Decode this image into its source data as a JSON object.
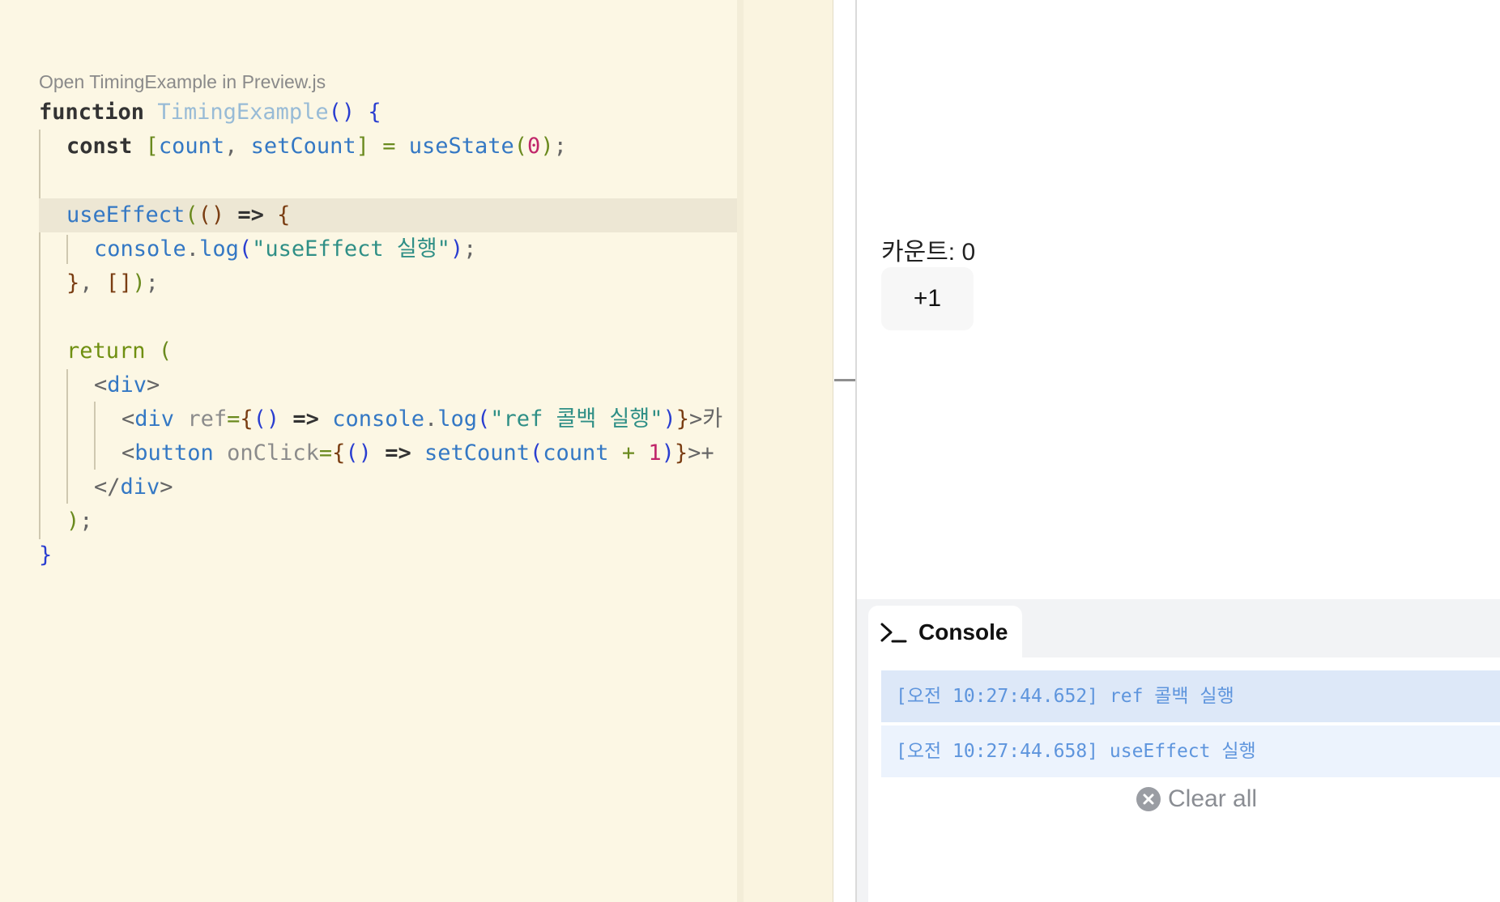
{
  "editor": {
    "open_link": "Open TimingExample in Preview.js",
    "code": {
      "l1_kw": "function",
      "l1_name": "TimingExample",
      "l1_paren": "()",
      "l1_brace": "{",
      "l2_kw": "const",
      "l2_lb": "[",
      "l2_count": "count",
      "l2_comma": ",",
      "l2_set": "setCount",
      "l2_rb": "]",
      "l2_eq": "=",
      "l2_fn": "useState",
      "l2_lp": "(",
      "l2_num": "0",
      "l2_rp": ")",
      "l2_semi": ";",
      "l4_fn": "useEffect",
      "l4_lp": "(",
      "l4_args": "()",
      "l4_arrow": "=>",
      "l4_brace": "{",
      "l5_obj": "console",
      "l5_dot": ".",
      "l5_fn": "log",
      "l5_lp": "(",
      "l5_str": "\"useEffect 실행\"",
      "l5_rp": ")",
      "l5_semi": ";",
      "l6_brace": "}",
      "l6_comma": ",",
      "l6_arr": "[]",
      "l6_rp": ")",
      "l6_semi": ";",
      "l8_kw": "return",
      "l8_lp": "(",
      "l9_open": "<",
      "l9_tag": "div",
      "l9_close": ">",
      "l10_open": "<",
      "l10_tag": "div",
      "l10_attr": "ref",
      "l10_eq": "=",
      "l10_lb": "{",
      "l10_args": "()",
      "l10_arrow": "=>",
      "l10_obj": "console",
      "l10_dot": ".",
      "l10_fn": "log",
      "l10_lp": "(",
      "l10_str": "\"ref 콜백 실행\"",
      "l10_rp": ")",
      "l10_rb": "}",
      "l10_rest": ">카",
      "l11_open": "<",
      "l11_tag": "button",
      "l11_attr": "onClick",
      "l11_eq": "=",
      "l11_lb": "{",
      "l11_args": "()",
      "l11_arrow": "=>",
      "l11_fn": "setCount",
      "l11_lp": "(",
      "l11_count": "count",
      "l11_plus": "+",
      "l11_num": "1",
      "l11_rp": ")",
      "l11_rb": "}",
      "l11_rest": ">+",
      "l12_open": "</",
      "l12_tag": "div",
      "l12_close": ">",
      "l13_rp": ")",
      "l13_semi": ";",
      "l14_brace": "}"
    }
  },
  "preview": {
    "count_label": "카운트: 0",
    "increment_label": "+1"
  },
  "console": {
    "tab_label": "Console",
    "logs": [
      "[오전 10:27:44.652] ref 콜백 실행",
      "[오전 10:27:44.658] useEffect 실행"
    ],
    "clear_all": "Clear all"
  },
  "colors": {
    "editor_bg": "#fcf7e4",
    "keyword": "#333333",
    "function": "#3478c4",
    "string": "#2f8f86",
    "number": "#c0266a",
    "log_text": "#5e95dd"
  }
}
